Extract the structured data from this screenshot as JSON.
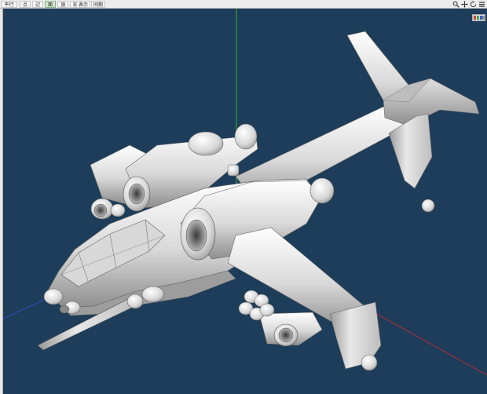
{
  "toolbar": {
    "buttons": [
      {
        "label": "平行",
        "active": false
      },
      {
        "label": "点",
        "active": false
      },
      {
        "label": "辺",
        "active": false
      },
      {
        "label": "面",
        "active": true
      },
      {
        "label": "頂",
        "active": false
      },
      {
        "label": "前",
        "active": false
      },
      {
        "label": "表示",
        "active": false
      },
      {
        "label": "同期",
        "active": false
      }
    ],
    "right_tools": [
      "zoom-icon",
      "move-icon",
      "rotate-icon",
      "menu-icon"
    ]
  },
  "viewport": {
    "background": "#1d3d5a",
    "axis_colors": {
      "x": "#b0303a",
      "y": "#2db83a",
      "z": "#2c4fb8"
    },
    "model": "helicopter"
  }
}
